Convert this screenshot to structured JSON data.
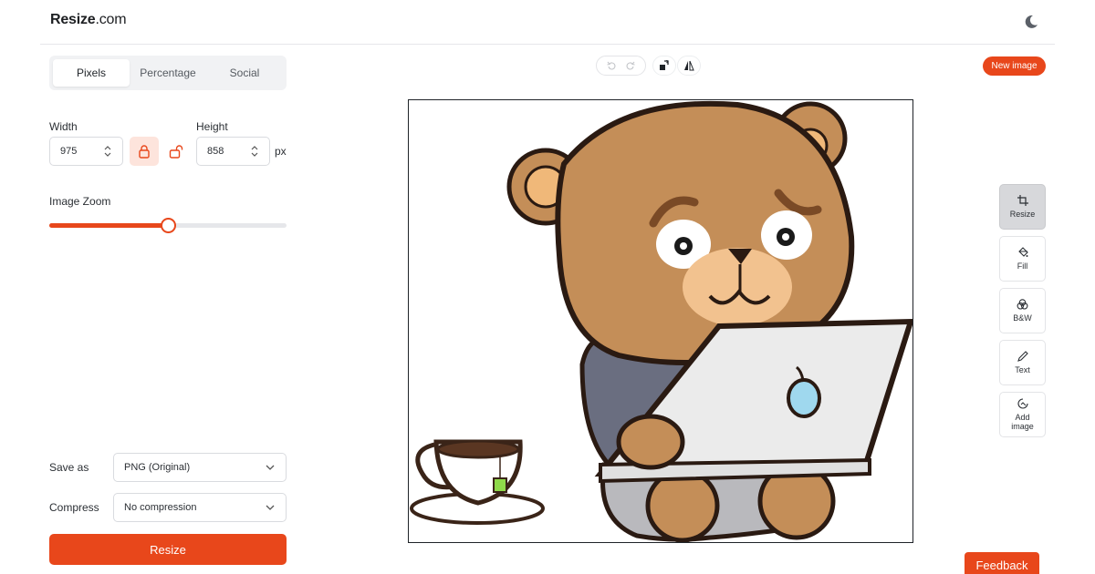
{
  "header": {
    "logo_main": "Resize",
    "logo_domain": ".com"
  },
  "tabs": [
    {
      "label": "Pixels",
      "active": true
    },
    {
      "label": "Percentage",
      "active": false
    },
    {
      "label": "Social",
      "active": false
    }
  ],
  "dimensions": {
    "width_label": "Width",
    "width_value": "975",
    "height_label": "Height",
    "height_value": "858",
    "unit": "px",
    "aspect_locked": true
  },
  "zoom": {
    "label": "Image Zoom",
    "level": 0.5
  },
  "save_as": {
    "label": "Save as",
    "value": "PNG (Original)"
  },
  "compress": {
    "label": "Compress",
    "value": "No compression"
  },
  "resize_button": "Resize",
  "new_image_button": "New image",
  "side_tools": [
    {
      "label": "Resize",
      "icon": "crop-icon",
      "active": true
    },
    {
      "label": "Fill",
      "icon": "paint-bucket-icon",
      "active": false
    },
    {
      "label": "B&W",
      "icon": "color-circles-icon",
      "active": false
    },
    {
      "label": "Text",
      "icon": "pencil-icon",
      "active": false
    },
    {
      "label": "Add image",
      "icon": "add-image-icon",
      "active": false
    }
  ],
  "feedback_button": "Feedback",
  "colors": {
    "accent": "#e8471b",
    "accent_light": "#fde4dc"
  }
}
